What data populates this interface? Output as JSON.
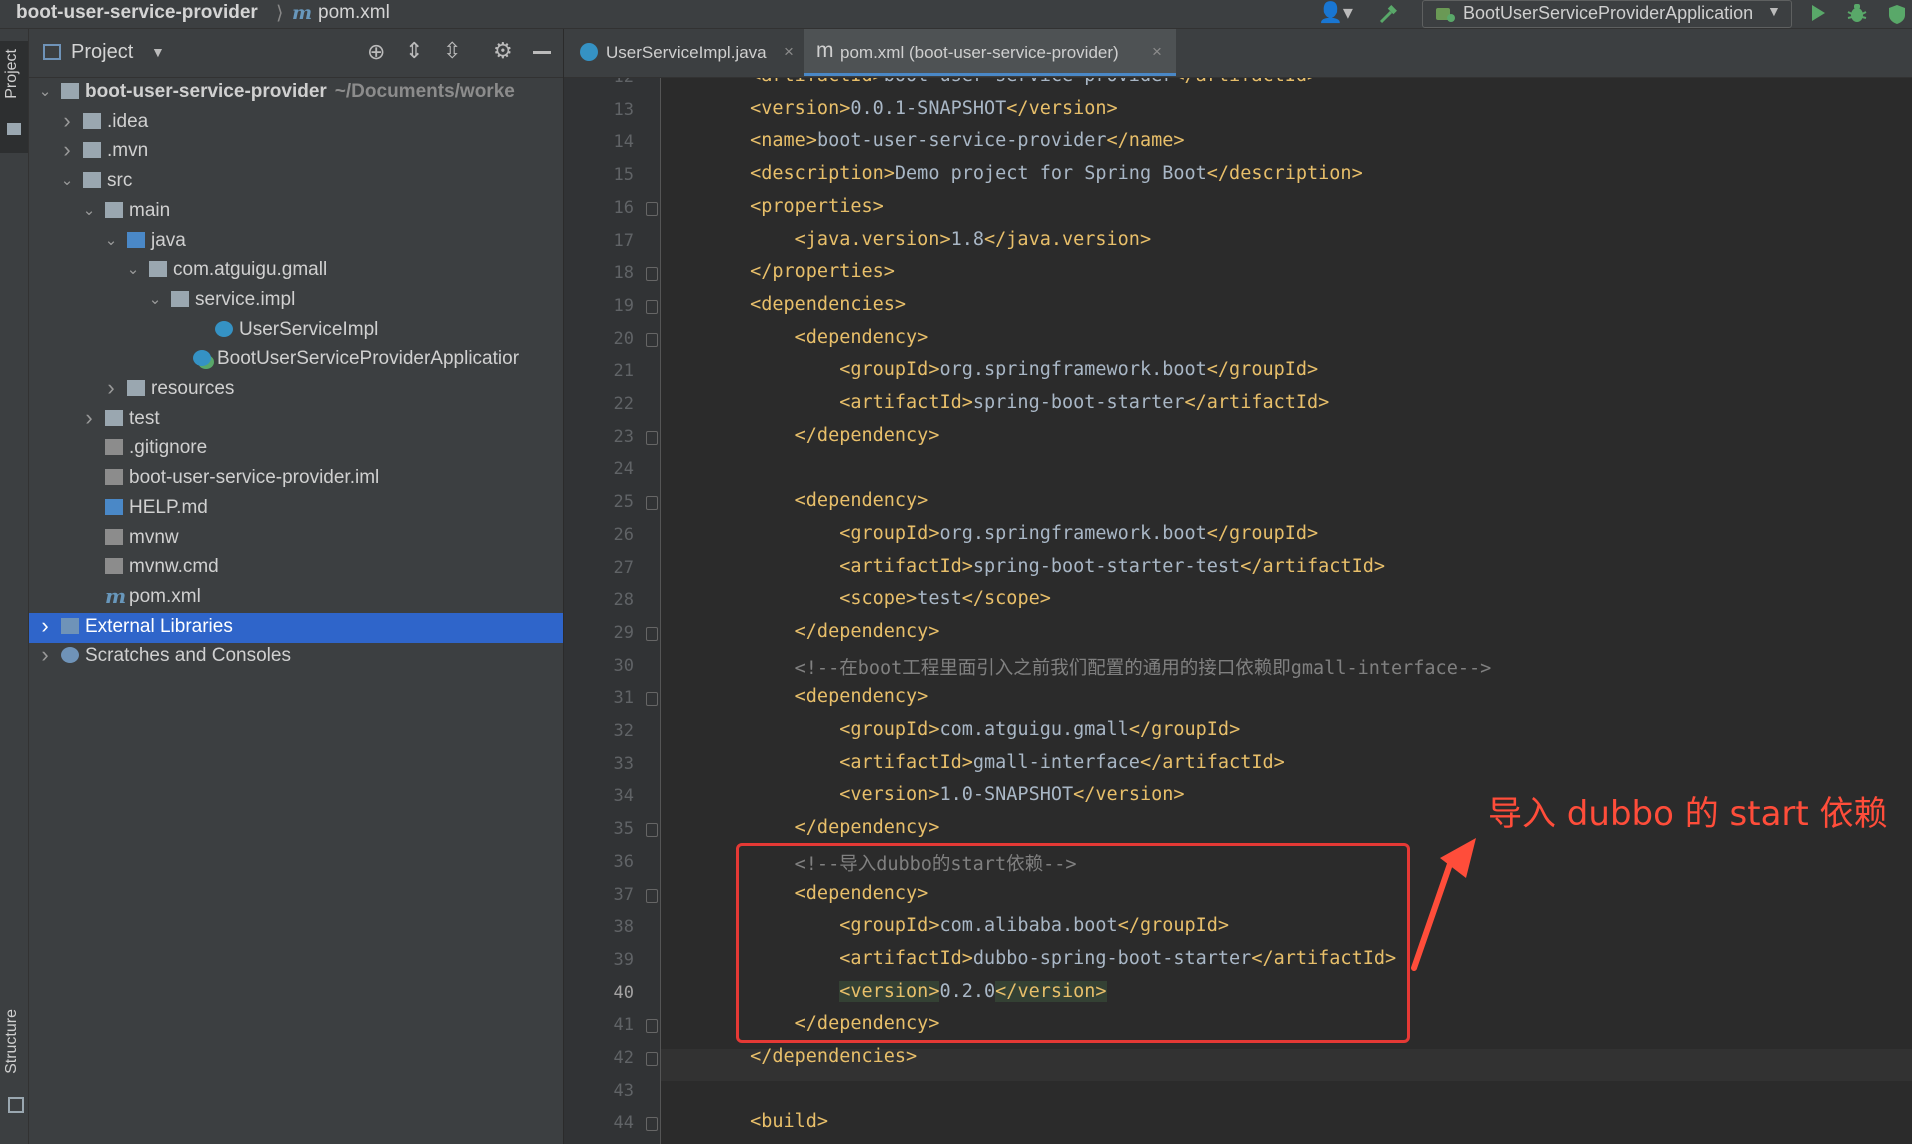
{
  "breadcrumb": {
    "project": "boot-user-service-provider",
    "file": "pom.xml"
  },
  "run_config": {
    "label": "BootUserServiceProviderApplication"
  },
  "left_strip": {
    "project_tab": "Project",
    "structure_tab": "Structure"
  },
  "project_panel": {
    "title": "Project",
    "items": [
      {
        "label": "boot-user-service-provider",
        "hint": "~/Documents/worke",
        "depth": 0,
        "arrow": "open",
        "icon": "module",
        "bold": true
      },
      {
        "label": ".idea",
        "depth": 1,
        "arrow": "closed",
        "icon": "folder"
      },
      {
        "label": ".mvn",
        "depth": 1,
        "arrow": "closed",
        "icon": "folder"
      },
      {
        "label": "src",
        "depth": 1,
        "arrow": "open",
        "icon": "folder"
      },
      {
        "label": "main",
        "depth": 2,
        "arrow": "open",
        "icon": "folder"
      },
      {
        "label": "java",
        "depth": 3,
        "arrow": "open",
        "icon": "folder-blue"
      },
      {
        "label": "com.atguigu.gmall",
        "depth": 4,
        "arrow": "open",
        "icon": "package"
      },
      {
        "label": "service.impl",
        "depth": 5,
        "arrow": "open",
        "icon": "package"
      },
      {
        "label": "UserServiceImpl",
        "depth": 7,
        "arrow": "none",
        "icon": "class"
      },
      {
        "label": "BootUserServiceProviderApplicatior",
        "depth": 6,
        "arrow": "none",
        "icon": "spring-class"
      },
      {
        "label": "resources",
        "depth": 3,
        "arrow": "closed",
        "icon": "resources"
      },
      {
        "label": "test",
        "depth": 2,
        "arrow": "closed",
        "icon": "folder"
      },
      {
        "label": ".gitignore",
        "depth": 2,
        "arrow": "none",
        "icon": "gitignore"
      },
      {
        "label": "boot-user-service-provider.iml",
        "depth": 2,
        "arrow": "none",
        "icon": "iml"
      },
      {
        "label": "HELP.md",
        "depth": 2,
        "arrow": "none",
        "icon": "md"
      },
      {
        "label": "mvnw",
        "depth": 2,
        "arrow": "none",
        "icon": "script"
      },
      {
        "label": "mvnw.cmd",
        "depth": 2,
        "arrow": "none",
        "icon": "file"
      },
      {
        "label": "pom.xml",
        "depth": 2,
        "arrow": "none",
        "icon": "maven"
      },
      {
        "label": "External Libraries",
        "depth": 0,
        "arrow": "closed",
        "icon": "libraries",
        "selected": true
      },
      {
        "label": "Scratches and Consoles",
        "depth": 0,
        "arrow": "closed",
        "icon": "scratches"
      }
    ]
  },
  "tabs": [
    {
      "label": "UserServiceImpl.java",
      "icon": "class",
      "active": false
    },
    {
      "label": "pom.xml (boot-user-service-provider)",
      "icon": "maven",
      "active": true
    }
  ],
  "editor": {
    "current_line": 40,
    "lines": [
      {
        "n": 12,
        "text": "        <artifactId>boot-user-service-provider</artifactId>"
      },
      {
        "n": 13,
        "text": "        <version>0.0.1-SNAPSHOT</version>"
      },
      {
        "n": 14,
        "text": "        <name>boot-user-service-provider</name>"
      },
      {
        "n": 15,
        "text": "        <description>Demo project for Spring Boot</description>"
      },
      {
        "n": 16,
        "text": "        <properties>",
        "fold": true
      },
      {
        "n": 17,
        "text": "            <java.version>1.8</java.version>"
      },
      {
        "n": 18,
        "text": "        </properties>",
        "fold": true
      },
      {
        "n": 19,
        "text": "        <dependencies>",
        "fold": true
      },
      {
        "n": 20,
        "text": "            <dependency>",
        "fold": true
      },
      {
        "n": 21,
        "text": "                <groupId>org.springframework.boot</groupId>"
      },
      {
        "n": 22,
        "text": "                <artifactId>spring-boot-starter</artifactId>"
      },
      {
        "n": 23,
        "text": "            </dependency>",
        "fold": true
      },
      {
        "n": 24,
        "text": ""
      },
      {
        "n": 25,
        "text": "            <dependency>",
        "fold": true
      },
      {
        "n": 26,
        "text": "                <groupId>org.springframework.boot</groupId>"
      },
      {
        "n": 27,
        "text": "                <artifactId>spring-boot-starter-test</artifactId>"
      },
      {
        "n": 28,
        "text": "                <scope>test</scope>"
      },
      {
        "n": 29,
        "text": "            </dependency>",
        "fold": true
      },
      {
        "n": 30,
        "text": "            <!--在boot工程里面引入之前我们配置的通用的接口依赖即gmall-interface-->"
      },
      {
        "n": 31,
        "text": "            <dependency>",
        "fold": true
      },
      {
        "n": 32,
        "text": "                <groupId>com.atguigu.gmall</groupId>"
      },
      {
        "n": 33,
        "text": "                <artifactId>gmall-interface</artifactId>"
      },
      {
        "n": 34,
        "text": "                <version>1.0-SNAPSHOT</version>"
      },
      {
        "n": 35,
        "text": "            </dependency>",
        "fold": true
      },
      {
        "n": 36,
        "text": "            <!--导入dubbo的start依赖-->"
      },
      {
        "n": 37,
        "text": "            <dependency>",
        "fold": true
      },
      {
        "n": 38,
        "text": "                <groupId>com.alibaba.boot</groupId>"
      },
      {
        "n": 39,
        "text": "                <artifactId>dubbo-spring-boot-starter</artifactId>"
      },
      {
        "n": 40,
        "text": "                <version>0.2.0</version>",
        "highlight": true
      },
      {
        "n": 41,
        "text": "            </dependency>",
        "fold": true
      },
      {
        "n": 42,
        "text": "        </dependencies>",
        "fold": true
      },
      {
        "n": 43,
        "text": ""
      },
      {
        "n": 44,
        "text": "        <build>",
        "fold": true
      }
    ]
  },
  "annotation": {
    "text": "导入 dubbo 的 start 依赖",
    "color": "#ff4d3a"
  }
}
